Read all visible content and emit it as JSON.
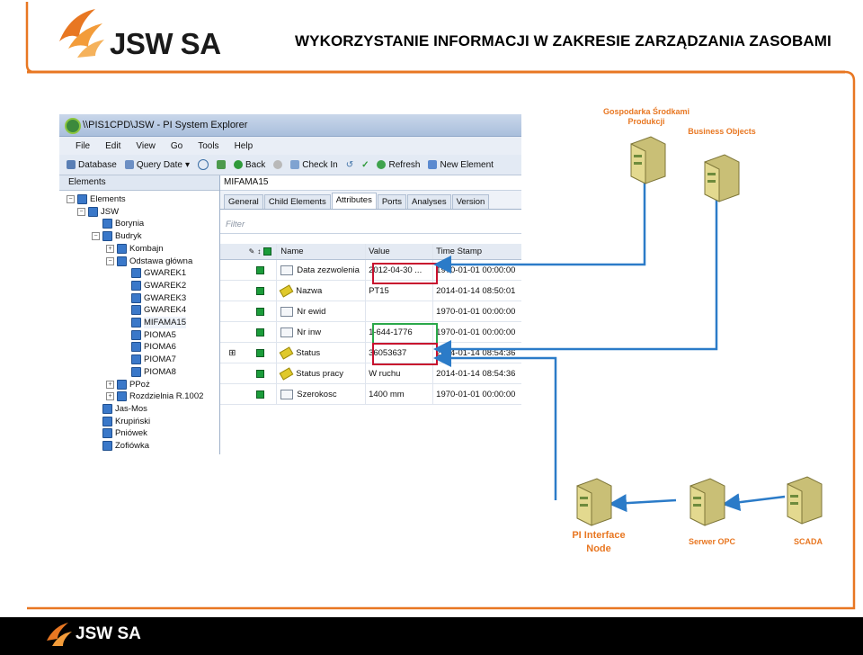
{
  "slide": {
    "title": "WYKORZYSTANIE INFORMACJI W ZAKRESIE ZARZĄDZANIA ZASOBAMI",
    "logo_text": "JSW SA",
    "footer_logo_text": "JSW SA",
    "accent_color": "#e87722"
  },
  "window": {
    "title": "\\\\PIS1CPD\\JSW - PI System Explorer",
    "menu": [
      "File",
      "Edit",
      "View",
      "Go",
      "Tools",
      "Help"
    ],
    "toolbar": {
      "database": "Database",
      "query_date": "Query Date",
      "back": "Back",
      "check_in": "Check In",
      "refresh": "Refresh",
      "new_element": "New Element"
    },
    "left_pane_title": "Elements",
    "tree": [
      "Elements",
      "JSW",
      "Borynia",
      "Budryk",
      "Kombajn",
      "Odstawa główna",
      "GWAREK1",
      "GWAREK2",
      "GWAREK3",
      "GWAREK4",
      "MIFAMA15",
      "PIOMA5",
      "PIOMA6",
      "PIOMA7",
      "PIOMA8",
      "PPoż",
      "Rozdzielnia R.1002",
      "Jas-Mos",
      "Krupiński",
      "Pniówek",
      "Zofiówka"
    ],
    "breadcrumb": "MIFAMA15",
    "tabs": [
      "General",
      "Child Elements",
      "Attributes",
      "Ports",
      "Analyses",
      "Version"
    ],
    "filter_placeholder": "Filter",
    "grid": {
      "headers": [
        "Name",
        "Value",
        "Time Stamp"
      ],
      "rows": [
        {
          "name": "Data zezwolenia",
          "value": "2012-04-30 ...",
          "time": "1970-01-01 00:00:00"
        },
        {
          "name": "Nazwa",
          "value": "PT15",
          "time": "2014-01-14 08:50:01"
        },
        {
          "name": "Nr ewid",
          "value": "",
          "time": "1970-01-01 00:00:00"
        },
        {
          "name": "Nr inw",
          "value": "1-644-1776",
          "time": "1970-01-01 00:00:00"
        },
        {
          "name": "Status",
          "value": "36053637",
          "time": "2014-01-14 08:54:36"
        },
        {
          "name": "Status pracy",
          "value": "W ruchu",
          "time": "2014-01-14 08:54:36"
        },
        {
          "name": "Szerokosc",
          "value": "1400 mm",
          "time": "1970-01-01 00:00:00"
        }
      ]
    }
  },
  "servers": {
    "gospodarka": "Gospodarka Środkami\nProdukcji",
    "business_objects": "Business Objects",
    "pi_interface": "PI Interface\nNode",
    "serwer_opc": "Serwer OPC",
    "scada": "SCADA"
  }
}
